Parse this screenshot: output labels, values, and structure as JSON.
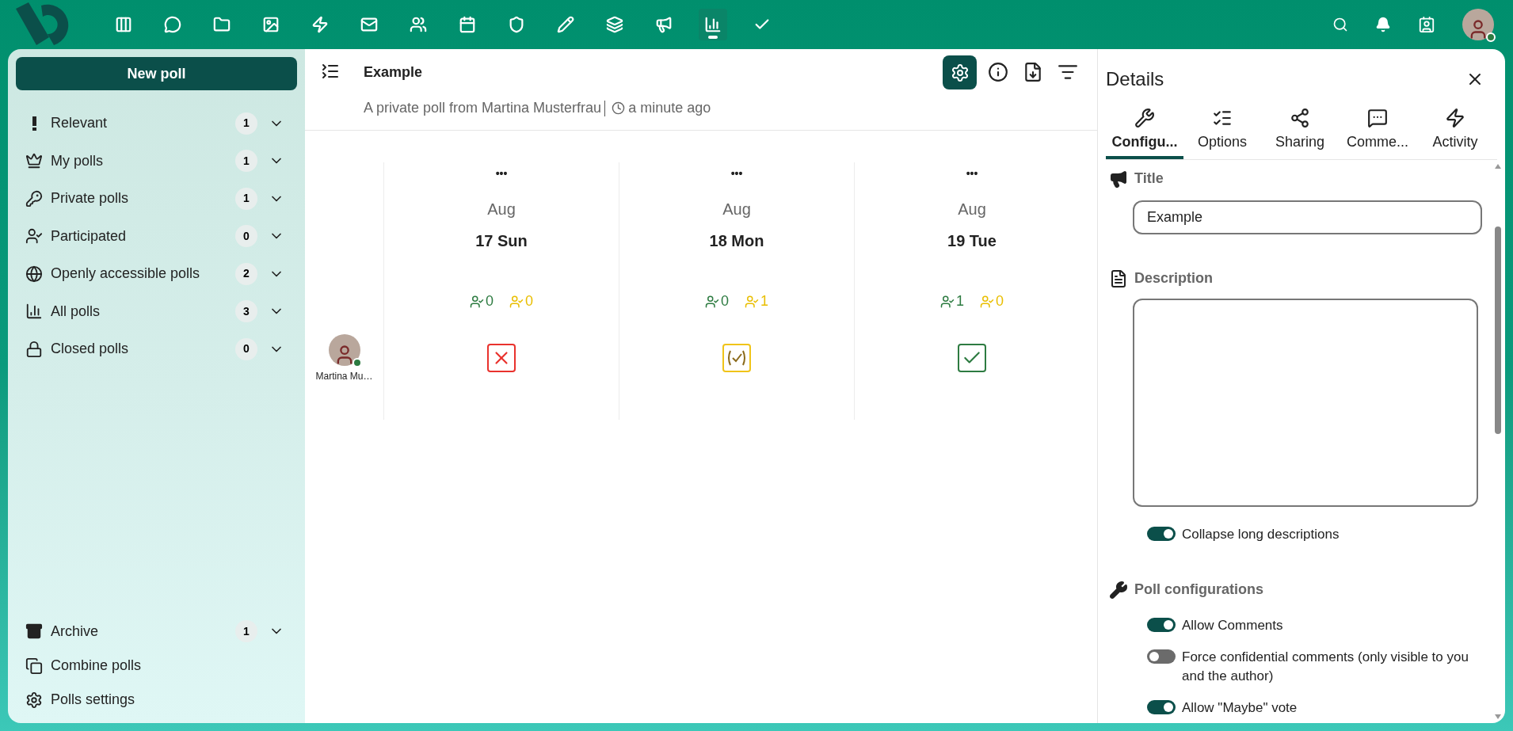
{
  "top_bar": {
    "apps": [
      {
        "selected": false
      },
      {
        "selected": false
      },
      {
        "selected": false
      },
      {
        "selected": false
      },
      {
        "selected": false
      },
      {
        "selected": false
      },
      {
        "selected": false
      },
      {
        "selected": false
      },
      {
        "selected": false
      },
      {
        "selected": false
      },
      {
        "selected": false
      },
      {
        "selected": false
      },
      {
        "selected": true
      },
      {
        "selected": false
      }
    ]
  },
  "sidebar": {
    "new_button": "New poll",
    "items": [
      {
        "label": "Relevant",
        "count": "1"
      },
      {
        "label": "My polls",
        "count": "1"
      },
      {
        "label": "Private polls",
        "count": "1"
      },
      {
        "label": "Participated",
        "count": "0"
      },
      {
        "label": "Openly accessible polls",
        "count": "2"
      },
      {
        "label": "All polls",
        "count": "3"
      },
      {
        "label": "Closed polls",
        "count": "0"
      }
    ],
    "archive": {
      "label": "Archive",
      "count": "1"
    },
    "footer_links": [
      "Combine polls",
      "Polls settings"
    ]
  },
  "poll": {
    "title": "Example",
    "subtitle": "A private poll from Martina Musterfrau",
    "time": "a minute ago",
    "participant": "Martina Mu…",
    "options": [
      {
        "menu": "•••",
        "month": "Aug",
        "day": "17 Sun",
        "yes": "0",
        "maybe": "0",
        "kind": "no"
      },
      {
        "menu": "•••",
        "month": "Aug",
        "day": "18 Mon",
        "yes": "0",
        "maybe": "1",
        "kind": "maybe"
      },
      {
        "menu": "•••",
        "month": "Aug",
        "day": "19 Tue",
        "yes": "1",
        "maybe": "0",
        "kind": "yes"
      }
    ]
  },
  "details": {
    "title": "Details",
    "tabs": [
      {
        "label": "Configu...",
        "selected": true
      },
      {
        "label": "Options",
        "selected": false
      },
      {
        "label": "Sharing",
        "selected": false
      },
      {
        "label": "Comme...",
        "selected": false
      },
      {
        "label": "Activity",
        "selected": false
      }
    ],
    "title_section": {
      "heading": "Title",
      "value": "Example"
    },
    "description_section": {
      "heading": "Description",
      "toggle": {
        "label": "Collapse long descriptions",
        "on": true
      }
    },
    "config_section": {
      "heading": "Poll configurations",
      "toggles": [
        {
          "label": "Allow Comments",
          "on": true
        },
        {
          "label": "Force confidential comments (only visible to you and the author)",
          "on": false
        },
        {
          "label": "Allow \"Maybe\" vote",
          "on": true
        }
      ]
    }
  }
}
